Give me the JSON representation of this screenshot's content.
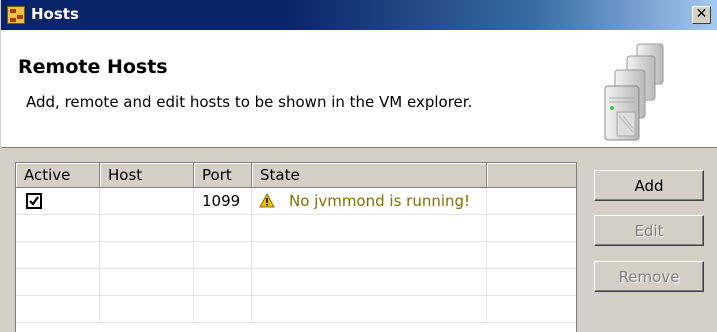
{
  "window": {
    "title": "Hosts",
    "close_glyph": "✕"
  },
  "header": {
    "title": "Remote Hosts",
    "description": "Add, remote and edit hosts to be shown in the VM explorer."
  },
  "table": {
    "columns": [
      "Active",
      "Host",
      "Port",
      "State",
      ""
    ],
    "rows": [
      {
        "active": true,
        "host": "",
        "port": "1099",
        "state": "No jvmmond is running!",
        "state_icon": "warning-icon"
      }
    ]
  },
  "buttons": {
    "add": "Add",
    "edit": "Edit",
    "remove": "Remove"
  },
  "colors": {
    "titlebar": "#0a246a",
    "state_text": "#807000",
    "warning": "#f0c000"
  }
}
